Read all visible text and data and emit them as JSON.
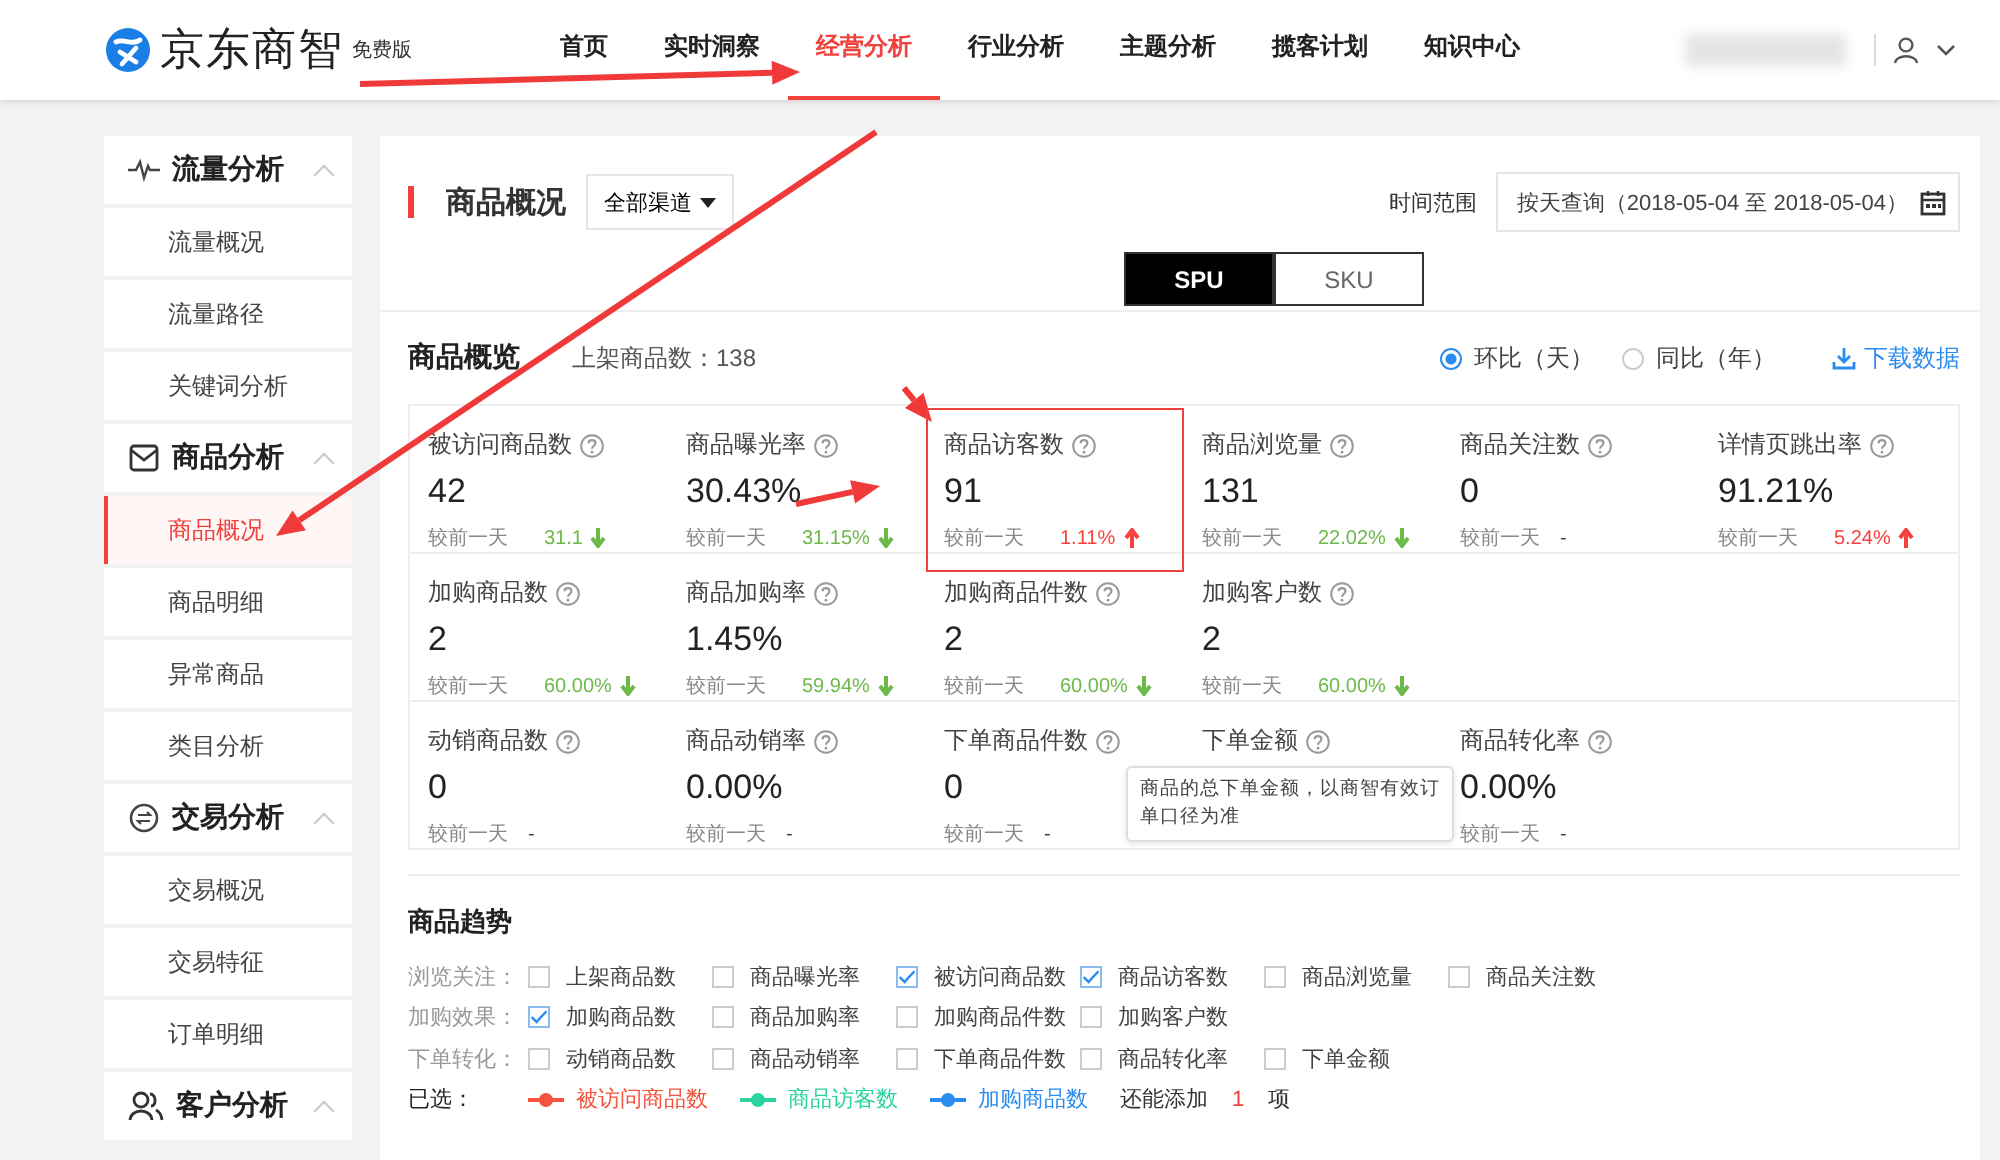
{
  "header": {
    "logo": "京东商智",
    "edition": "免费版",
    "nav": [
      {
        "label": "首页",
        "selected": false
      },
      {
        "label": "实时洞察",
        "selected": false
      },
      {
        "label": "经营分析",
        "selected": true
      },
      {
        "label": "行业分析",
        "selected": false
      },
      {
        "label": "主题分析",
        "selected": false
      },
      {
        "label": "揽客计划",
        "selected": false
      },
      {
        "label": "知识中心",
        "selected": false
      }
    ]
  },
  "sidebar": [
    {
      "title": "流量分析",
      "expanded": true,
      "items": [
        {
          "label": "流量概况",
          "selected": false
        },
        {
          "label": "流量路径",
          "selected": false
        },
        {
          "label": "关键词分析",
          "selected": false
        }
      ]
    },
    {
      "title": "商品分析",
      "expanded": true,
      "items": [
        {
          "label": "商品概况",
          "selected": true
        },
        {
          "label": "商品明细",
          "selected": false
        },
        {
          "label": "异常商品",
          "selected": false
        },
        {
          "label": "类目分析",
          "selected": false
        }
      ]
    },
    {
      "title": "交易分析",
      "expanded": true,
      "items": [
        {
          "label": "交易概况",
          "selected": false
        },
        {
          "label": "交易特征",
          "selected": false
        },
        {
          "label": "订单明细",
          "selected": false
        }
      ]
    },
    {
      "title": "客户分析",
      "expanded": true
    }
  ],
  "page": {
    "title": "商品概况",
    "channel": "全部渠道",
    "time_label": "时间范围",
    "date_range": "按天查询（2018-05-04 至 2018-05-04）",
    "views": [
      {
        "label": "SPU",
        "selected": true
      },
      {
        "label": "SKU",
        "selected": false
      }
    ]
  },
  "overview": {
    "title": "商品概览",
    "listed": "上架商品数：138",
    "compare_modes": [
      {
        "label": "环比（天）",
        "selected": true
      },
      {
        "label": "同比（年）",
        "selected": false
      }
    ],
    "download": "下载数据",
    "metrics": [
      [
        {
          "label": "被访问商品数",
          "value": "42",
          "compare": "较前一天",
          "change": "31.1",
          "kind": "fall",
          "highlighted": false
        },
        {
          "label": "商品曝光率",
          "value": "30.43%",
          "compare": "较前一天",
          "change": "31.15%",
          "kind": "fall",
          "highlighted": false
        },
        {
          "label": "商品访客数",
          "value": "91",
          "compare": "较前一天",
          "change": "1.11%",
          "kind": "rise",
          "highlighted": true
        },
        {
          "label": "商品浏览量",
          "value": "131",
          "compare": "较前一天",
          "change": "22.02%",
          "kind": "fall",
          "highlighted": false
        },
        {
          "label": "商品关注数",
          "value": "0",
          "compare": "较前一天",
          "change": "-",
          "kind": "flat",
          "highlighted": false
        },
        {
          "label": "详情页跳出率",
          "value": "91.21%",
          "compare": "较前一天",
          "change": "5.24%",
          "kind": "rise",
          "highlighted": false
        }
      ],
      [
        {
          "label": "加购商品数",
          "value": "2",
          "compare": "较前一天",
          "change": "60.00%",
          "kind": "fall",
          "highlighted": false
        },
        {
          "label": "商品加购率",
          "value": "1.45%",
          "compare": "较前一天",
          "change": "59.94%",
          "kind": "fall",
          "highlighted": false
        },
        {
          "label": "加购商品件数",
          "value": "2",
          "compare": "较前一天",
          "change": "60.00%",
          "kind": "fall",
          "highlighted": false
        },
        {
          "label": "加购客户数",
          "value": "2",
          "compare": "较前一天",
          "change": "60.00%",
          "kind": "fall",
          "highlighted": false
        }
      ],
      [
        {
          "label": "动销商品数",
          "value": "0",
          "compare": "较前一天",
          "change": "-",
          "kind": "flat",
          "highlighted": false
        },
        {
          "label": "商品动销率",
          "value": "0.00%",
          "compare": "较前一天",
          "change": "-",
          "kind": "flat",
          "highlighted": false
        },
        {
          "label": "下单商品件数",
          "value": "0",
          "compare": "较前一天",
          "change": "-",
          "kind": "flat",
          "highlighted": false
        },
        {
          "label": "下单金额",
          "tooltip": "商品的总下单金额，以商智有效订单口径为准",
          "highlighted": false
        },
        {
          "label": "商品转化率",
          "value": "0.00%",
          "compare": "较前一天",
          "change": "-",
          "kind": "flat",
          "highlighted": false
        }
      ]
    ]
  },
  "trends": {
    "title": "商品趋势",
    "groups": [
      {
        "label": "浏览关注：",
        "options": [
          {
            "label": "上架商品数",
            "checked": false
          },
          {
            "label": "商品曝光率",
            "checked": false
          },
          {
            "label": "被访问商品数",
            "checked": true
          },
          {
            "label": "商品访客数",
            "checked": true
          },
          {
            "label": "商品浏览量",
            "checked": false
          },
          {
            "label": "商品关注数",
            "checked": false
          }
        ]
      },
      {
        "label": "加购效果：",
        "options": [
          {
            "label": "加购商品数",
            "checked": true
          },
          {
            "label": "商品加购率",
            "checked": false
          },
          {
            "label": "加购商品件数",
            "checked": false
          },
          {
            "label": "加购客户数",
            "checked": false
          }
        ]
      },
      {
        "label": "下单转化：",
        "options": [
          {
            "label": "动销商品数",
            "checked": false
          },
          {
            "label": "商品动销率",
            "checked": false
          },
          {
            "label": "下单商品件数",
            "checked": false
          },
          {
            "label": "商品转化率",
            "checked": false
          },
          {
            "label": "下单金额",
            "checked": false
          }
        ]
      }
    ],
    "selected_label": "已选：",
    "selected": [
      {
        "label": "被访问商品数",
        "color": "#f5533d"
      },
      {
        "label": "商品访客数",
        "color": "#2ad3a0"
      },
      {
        "label": "加购商品数",
        "color": "#2b8cf0"
      }
    ],
    "remaining": {
      "prefix": "还能添加",
      "count": "1",
      "suffix": "项"
    }
  }
}
